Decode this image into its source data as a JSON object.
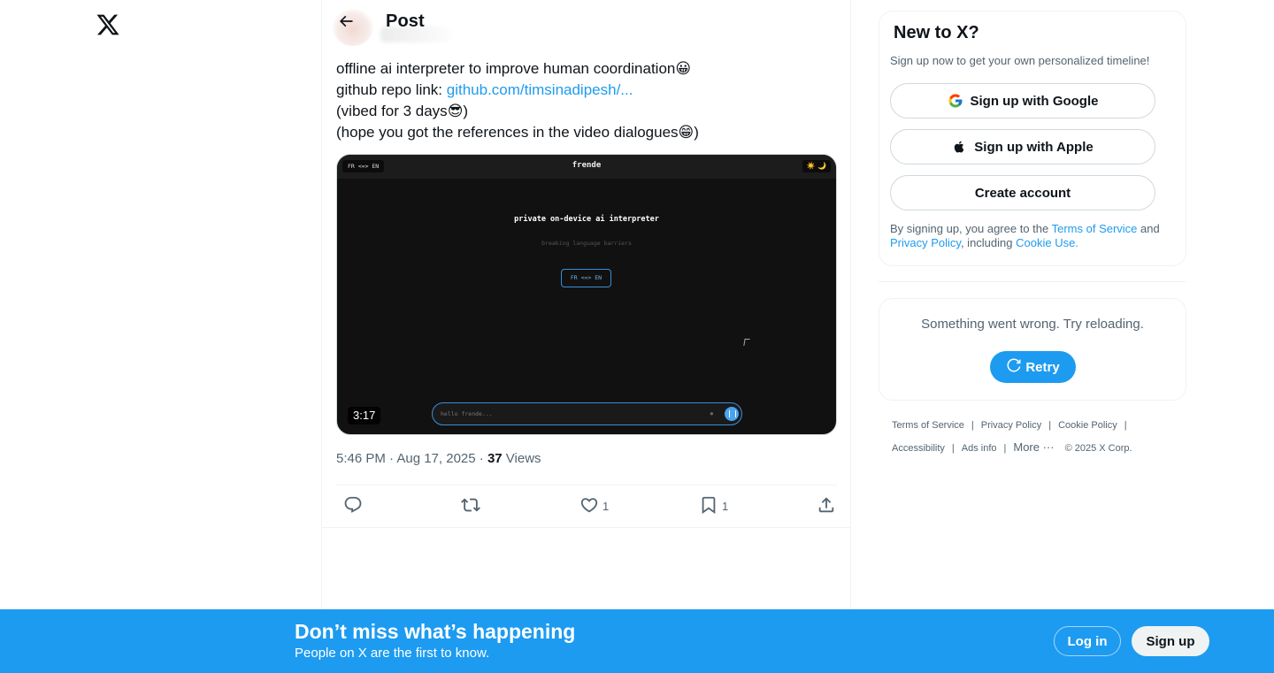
{
  "header": {
    "title": "Post"
  },
  "tweet": {
    "lines": [
      {
        "text": "offline ai interpreter to improve human coordination",
        "emoji": "😀"
      },
      {
        "text": "github repo link: ",
        "link": "github.com/timsinadipesh/..."
      },
      {
        "text": "(vibed for 3 days",
        "emoji": "😎",
        "after": ")"
      },
      {
        "text": "(hope you got the references in the video dialogues",
        "emoji": "😁",
        "after": ")"
      }
    ],
    "video": {
      "lang_pill": "FR <=> EN",
      "brand": "frende",
      "theme_icons": "☀️ 🌙",
      "heading": "private on-device ai interpreter",
      "subheading": "breaking language barriers",
      "lang_button": "FR <=> EN",
      "input_placeholder": "hello frende...",
      "duration": "3:17"
    },
    "time": "5:46 PM · Aug 17, 2025 · ",
    "views_count": "37",
    "views_label": " Views",
    "like_count": "1",
    "bookmark_count": "1"
  },
  "sidebar": {
    "new_title": "New to X?",
    "new_sub": "Sign up now to get your own personalized timeline!",
    "google_label": "Sign up with Google",
    "apple_label": "Sign up with Apple",
    "create_label": "Create account",
    "terms_prefix": "By signing up, you agree to the ",
    "terms_link": "Terms of Service",
    "terms_and": " and ",
    "privacy_link": "Privacy Policy",
    "including": ", including ",
    "cookie_link": "Cookie Use.",
    "error_text": "Something went wrong. Try reloading.",
    "retry_label": "Retry"
  },
  "footer": {
    "terms": "Terms of Service",
    "privacy": "Privacy Policy",
    "cookie": "Cookie Policy",
    "accessibility": "Accessibility",
    "ads": "Ads info",
    "more": "More ···",
    "copyright": "© 2025 X Corp.",
    "sep": "|"
  },
  "banner": {
    "heading": "Don’t miss what’s happening",
    "sub": "People on X are the first to know.",
    "login": "Log in",
    "signup": "Sign up"
  },
  "colors": {
    "accent": "#1d9bf0",
    "text": "#0f1419",
    "muted": "#536471",
    "border": "#eff3f4"
  },
  "icons": [
    "x-logo-icon",
    "back-arrow-icon",
    "reply-icon",
    "repost-icon",
    "like-icon",
    "bookmark-icon",
    "share-icon",
    "google-icon",
    "apple-icon",
    "refresh-icon"
  ]
}
